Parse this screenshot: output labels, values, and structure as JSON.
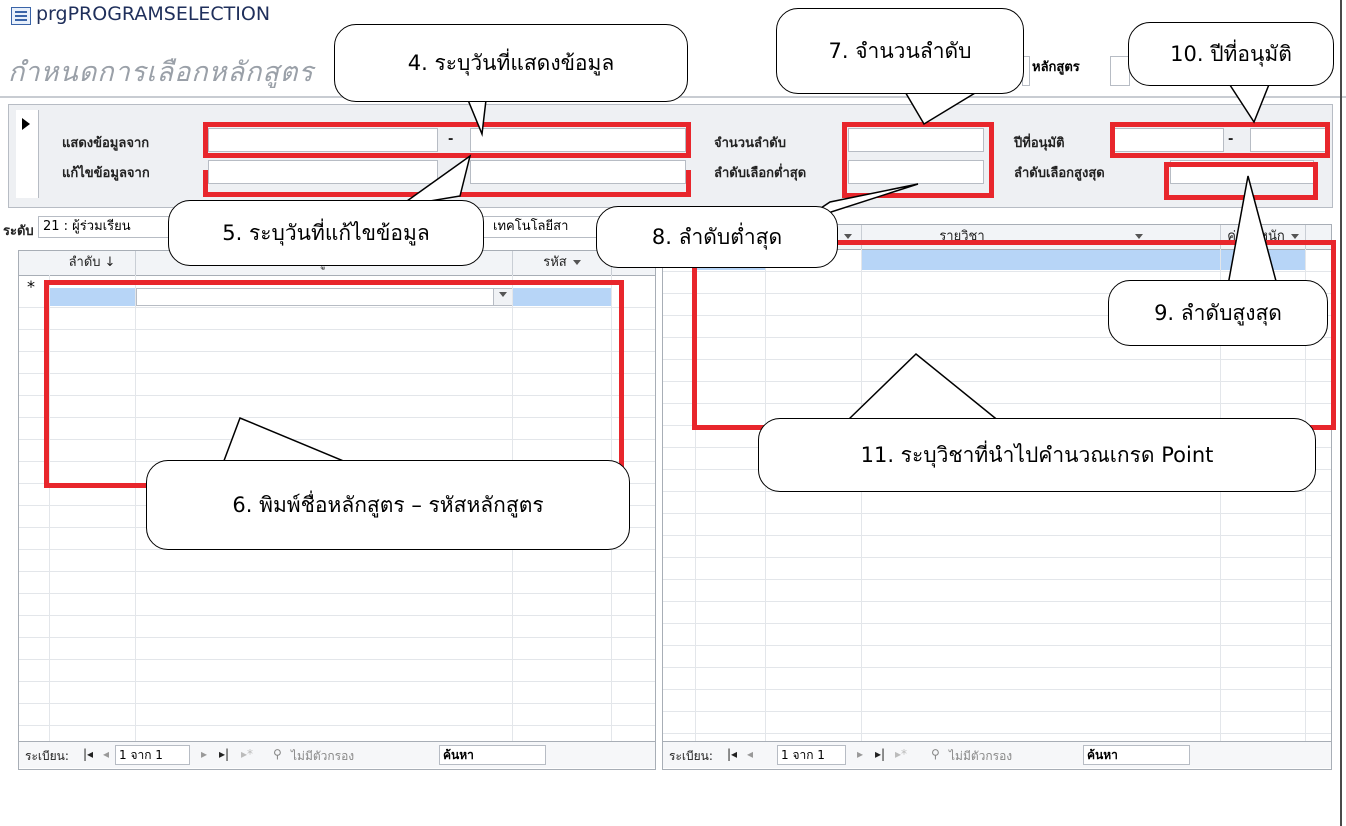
{
  "window": {
    "title": "prgPROGRAMSELECTION"
  },
  "header": {
    "heading": "กำหนดการเลือกหลักสูตร",
    "program_label": "หลักสูตร"
  },
  "form": {
    "show_from_label": "แสดงข้อมูลจาก",
    "edit_from_label": "แก้ไขข้อมูลจาก",
    "dash": "-",
    "rank_count_label": "จำนวนลำดับ",
    "min_rank_label": "ลำดับเลือกต่ำสุด",
    "approve_year_label": "ปีที่อนุมัติ",
    "max_rank_label": "ลำดับเลือกสูงสุด"
  },
  "level": {
    "label": "ระดับ",
    "value": "21 : ผู้ร่วมเรียน",
    "dept_value": "เทคโนโลยีสา"
  },
  "left_grid": {
    "columns": [
      "ลำดับ",
      "หลักสูตร",
      "รหัส"
    ],
    "new_row_marker": "*"
  },
  "right_grid": {
    "columns": [
      "รายวิชา",
      "ค่าน้ำหนัก"
    ]
  },
  "left_nav": {
    "record_label": "ระเบียน:",
    "position": "1 จาก 1",
    "filter": "ไม่มีตัวกรอง",
    "search": "ค้นหา"
  },
  "right_nav": {
    "record_label": "ระเบียน:",
    "position": "1 จาก 1",
    "filter": "ไม่มีตัวกรอง",
    "search": "ค้นหา"
  },
  "callouts": {
    "c4": "4.  ระบุวันที่แสดงข้อมูล",
    "c5": "5.  ระบุวันที่แก้ไขข้อมูล",
    "c6": "6. พิมพ์ชื่อหลักสูตร – รหัสหลักสูตร",
    "c7": "7.  จำนวนลำดับ",
    "c8": "8.  ลำดับต่ำสุด",
    "c9": "9.  ลำดับสูงสุด",
    "c10": "10.  ปีที่อนุมัติ",
    "c11": "11.  ระบุวิชาที่นำไปคำนวณเกรด Point"
  },
  "colors": {
    "highlight": "#e8262c",
    "selected_cell": "#b7d5f7"
  }
}
